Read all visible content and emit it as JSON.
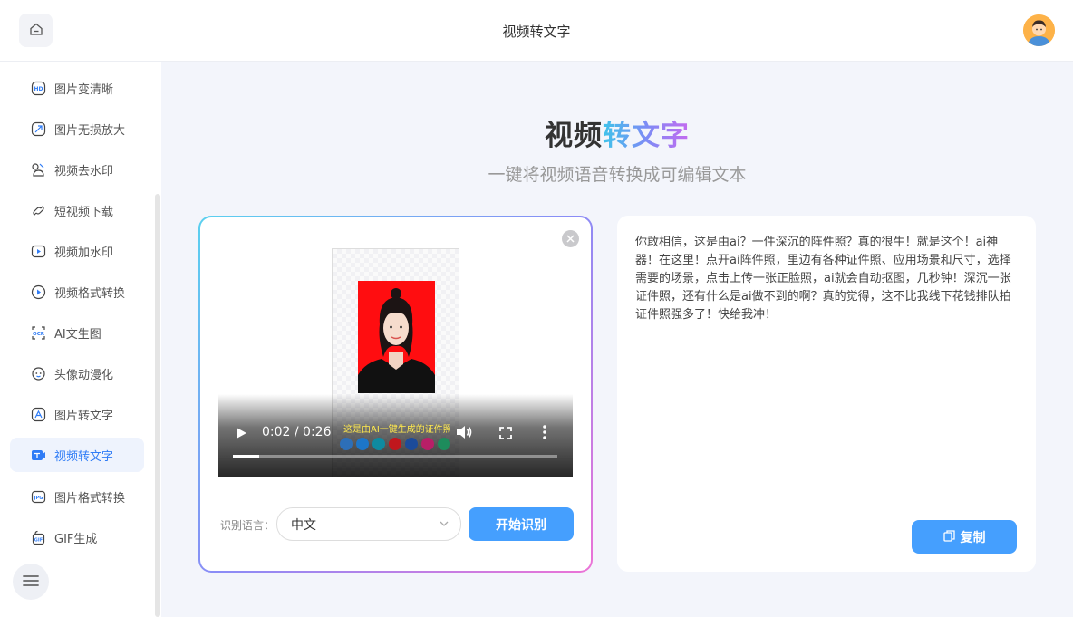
{
  "header": {
    "title": "视频转文字"
  },
  "sidebar": {
    "items": [
      {
        "label": "图片变清晰",
        "icon": "hd-icon",
        "active": false
      },
      {
        "label": "图片无损放大",
        "icon": "enlarge-icon",
        "active": false
      },
      {
        "label": "视频去水印",
        "icon": "watermark-remove-icon",
        "active": false
      },
      {
        "label": "短视频下载",
        "icon": "link-download-icon",
        "active": false
      },
      {
        "label": "视频加水印",
        "icon": "watermark-add-icon",
        "active": false
      },
      {
        "label": "视频格式转换",
        "icon": "play-circle-icon",
        "active": false
      },
      {
        "label": "AI文生图",
        "icon": "ai-scan-icon",
        "active": false
      },
      {
        "label": "头像动漫化",
        "icon": "anime-avatar-icon",
        "active": false
      },
      {
        "label": "图片转文字",
        "icon": "image-text-icon",
        "active": false
      },
      {
        "label": "视频转文字",
        "icon": "video-text-icon",
        "active": true
      },
      {
        "label": "图片格式转换",
        "icon": "image-format-icon",
        "active": false
      },
      {
        "label": "GIF生成",
        "icon": "gif-icon",
        "active": false
      }
    ]
  },
  "main": {
    "title_part1": "视频",
    "title_part2": "转文字",
    "subtitle": "一键将视频语音转换成可编辑文本"
  },
  "video": {
    "time": "0:02 / 0:26",
    "progress": 0.08,
    "subtitle": "这是由AI一键生成的证件照"
  },
  "controls": {
    "lang_label": "识别语言：",
    "lang_value": "中文",
    "start_label": "开始识别"
  },
  "result": {
    "text": "你敢相信，这是由ai？一件深沉的阵件照？真的很牛！就是这个！ai神器！在这里！点开ai阵件照，里边有各种证件照、应用场景和尺寸，选择需要的场景，点击上传一张正脸照，ai就会自动抠图，几秒钟！深沉一张证件照，还有什么是ai做不到的啊？真的觉得，这不比我线下花钱排队拍证件照强多了！快给我冲！",
    "copy_label": "复制"
  },
  "colors": {
    "accent": "#459ffe",
    "active_bg": "#eef3fd",
    "active_text": "#2f7cf6"
  }
}
